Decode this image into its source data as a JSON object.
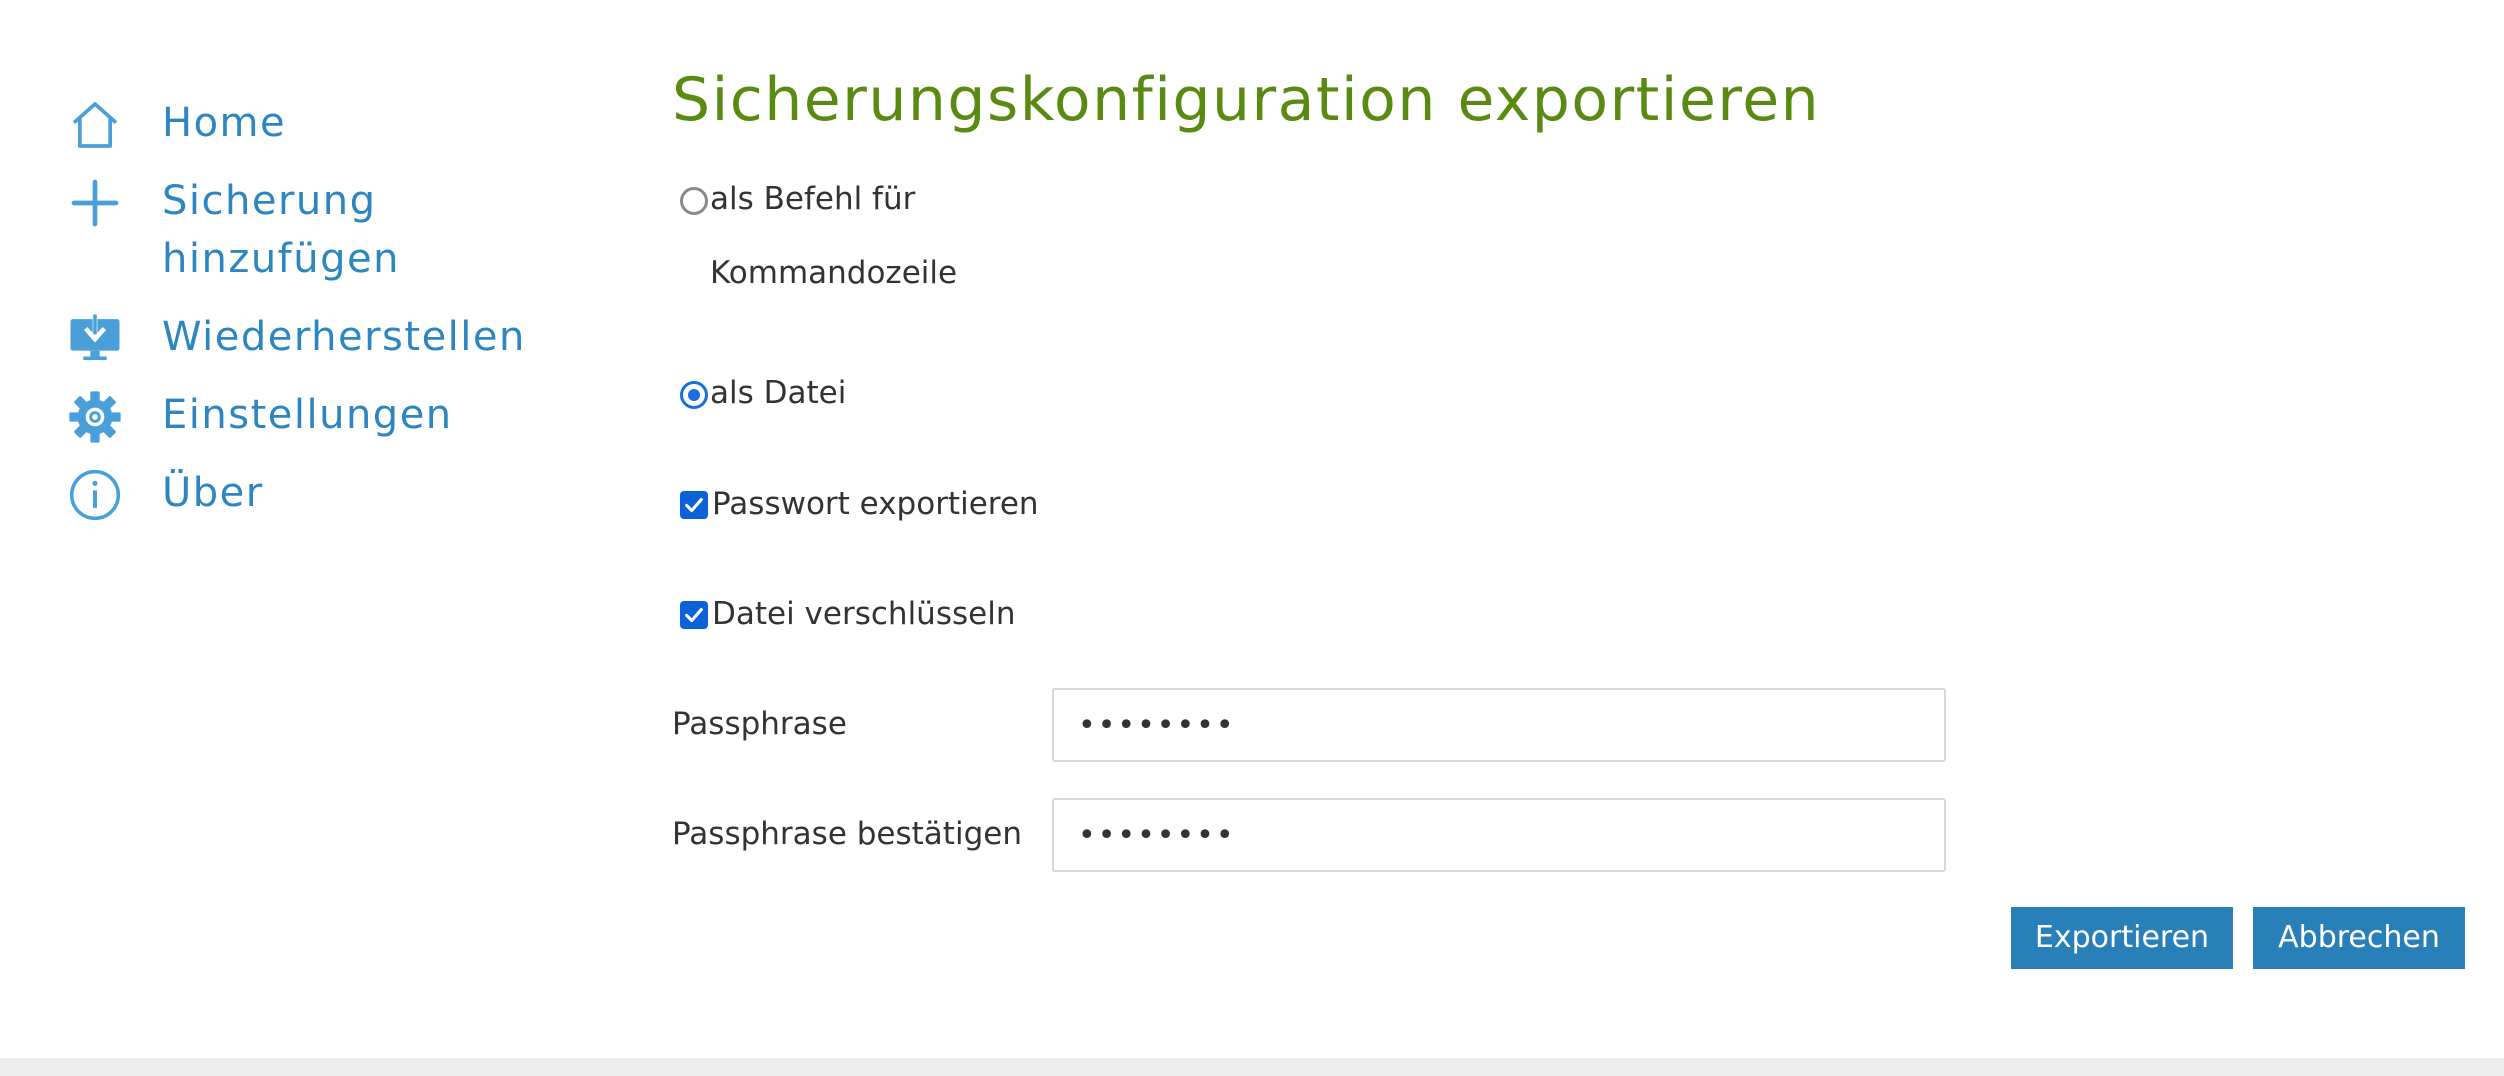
{
  "sidebar": {
    "items": [
      {
        "label": "Home",
        "icon": "home-icon"
      },
      {
        "label": "Sicherung",
        "label2": "hinzufügen",
        "icon": "plus-icon"
      },
      {
        "label": "Wiederherstellen",
        "icon": "restore-monitor-icon"
      },
      {
        "label": "Einstellungen",
        "icon": "gear-icon"
      },
      {
        "label": "Über",
        "icon": "info-icon"
      }
    ],
    "color": "#2e86c1"
  },
  "main": {
    "title": "Sicherungskonfiguration exportieren",
    "title_color": "#5a8a12",
    "export_mode": {
      "options": [
        {
          "label": "als Befehl für",
          "label2": "Kommandozeile",
          "checked": false
        },
        {
          "label": "als Datei",
          "checked": true
        }
      ]
    },
    "export_password": {
      "label": "Passwort exportieren",
      "checked": true
    },
    "encrypt_file": {
      "label": "Datei verschlüsseln",
      "checked": true
    },
    "passphrase": {
      "label": "Passphrase",
      "value": "abcdefgh"
    },
    "passphrase_confirm": {
      "label": "Passphrase bestätigen",
      "value": "abcdefgh"
    },
    "buttons": {
      "export": "Exportieren",
      "cancel": "Abbrechen"
    },
    "button_color": "#2980b9"
  }
}
